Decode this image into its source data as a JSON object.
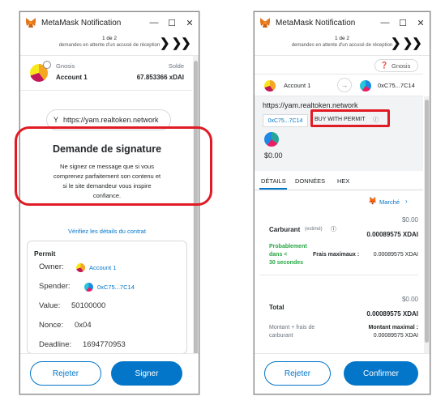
{
  "left": {
    "window_title": "MetaMask Notification",
    "queue_count": "1 de 2",
    "queue_subtitle": "demandes en attente d'un accusé de réception",
    "network": "Gnosis",
    "balance_label": "Solde",
    "account": "Account 1",
    "balance": "67.853366 xDAI",
    "origin_url": "https://yam.realtoken.network",
    "signature_title": "Demande de signature",
    "signature_desc_1": "Ne signez ce message que si vous",
    "signature_desc_2": "comprenez parfaitement son contenu et",
    "signature_desc_3": "si le site demandeur vous inspire",
    "signature_desc_4": "confiance.",
    "verify_link": "Vérifiez les détails du contrat",
    "permit": {
      "title": "Permit",
      "owner_label": "Owner:",
      "owner_value": "Account 1",
      "spender_label": "Spender:",
      "spender_value": "0xC75...7C14",
      "value_label": "Value:",
      "value_value": "50100000",
      "nonce_label": "Nonce:",
      "nonce_value": "0x04",
      "deadline_label": "Deadline:",
      "deadline_value": "1694770953"
    },
    "reject": "Rejeter",
    "sign": "Signer"
  },
  "right": {
    "window_title": "MetaMask Notification",
    "queue_count": "1 de 2",
    "queue_subtitle": "demandes en attente d'un accusé de réception",
    "network": "Gnosis",
    "from_account": "Account 1",
    "to_address": "0xC75...7C14",
    "origin_url": "https://yam.realtoken.network",
    "contract_chip": "0xC75...7C14",
    "method": "BUY WITH PERMIT",
    "amount": "$0.00",
    "tabs": [
      "DÉTAILS",
      "DONNÉES",
      "HEX"
    ],
    "market": "Marché",
    "fee_usd": "$0.00",
    "fee_label": "Carburant",
    "fee_estimated": "(estimé)",
    "fee_xdai": "0.00089575 XDAI",
    "likely_1": "Probablement",
    "likely_2": "dans <",
    "likely_3": "30 secondes",
    "max_fee_label": "Frais maximaux :",
    "max_fee_value": "0.00089575 XDAI",
    "total_usd": "$0.00",
    "total_label": "Total",
    "total_xdai": "0.00089575 XDAI",
    "amount_fee_1": "Montant + frais de",
    "amount_fee_2": "carburant",
    "max_amount_label": "Montant maximal :",
    "max_amount_value": "0.00089575 XDAI",
    "reject": "Rejeter",
    "confirm": "Confirmer"
  },
  "colors": {
    "accent": "#0376c9",
    "highlight": "#e01b24",
    "success": "#28a745",
    "fox": "#e2761b"
  }
}
